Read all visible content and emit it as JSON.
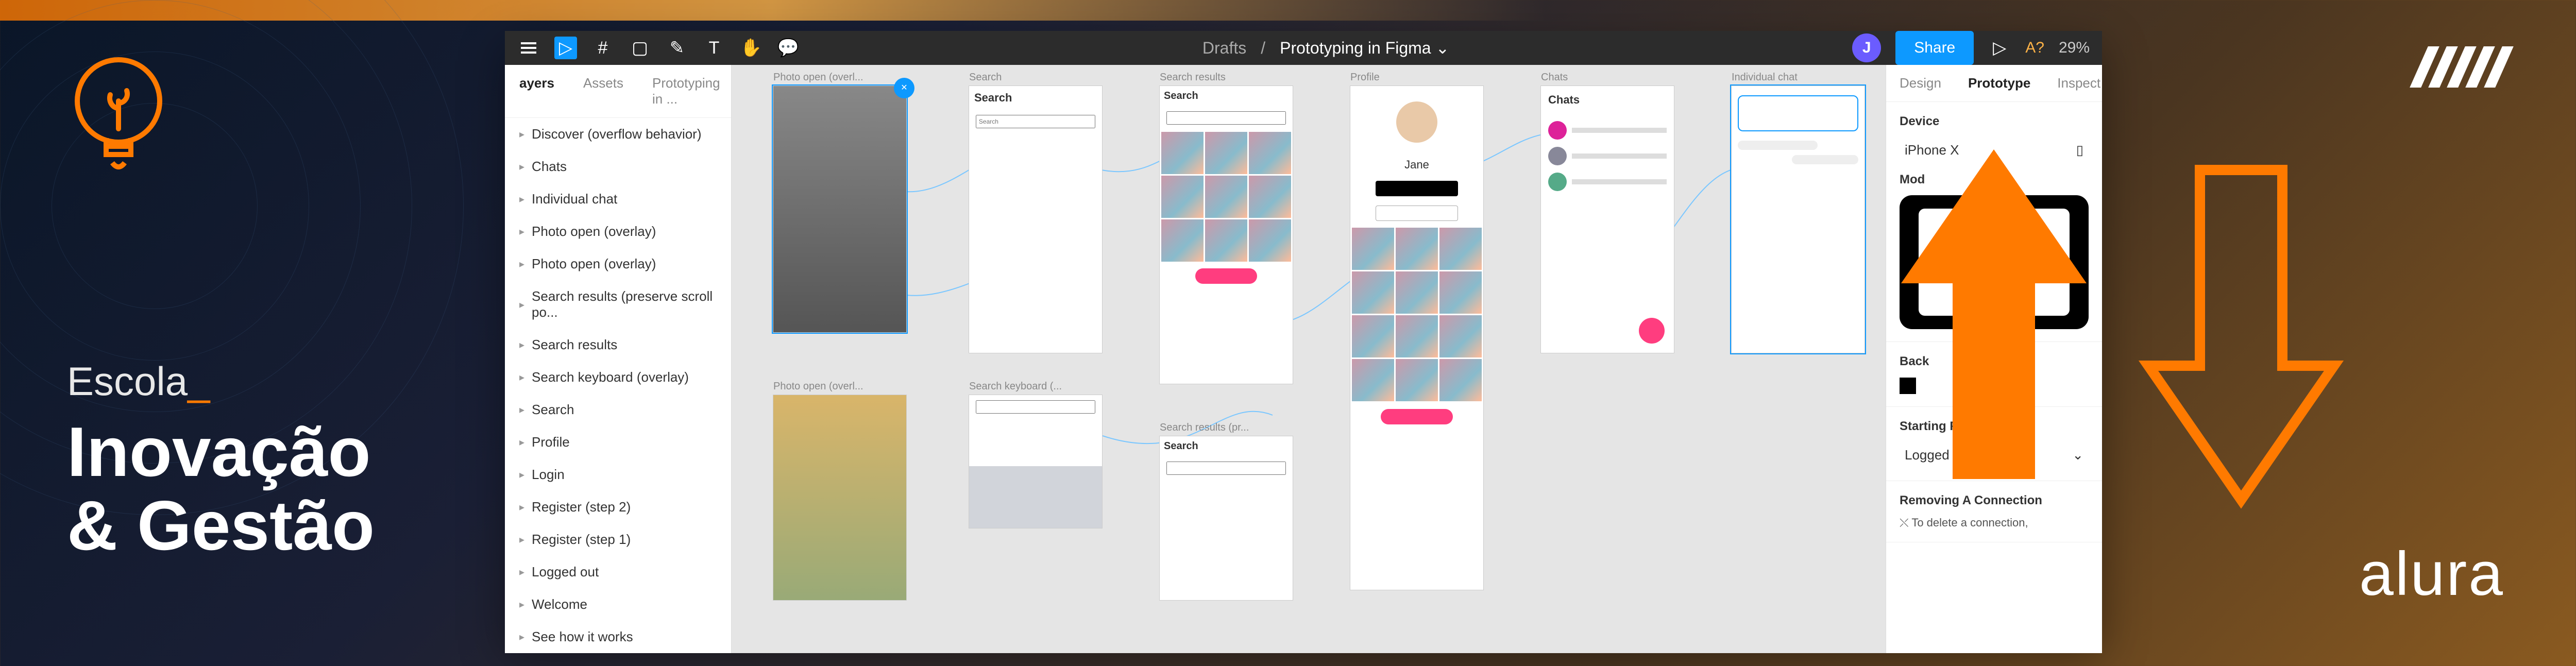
{
  "brand": {
    "school_label": "Escola",
    "cursor": "_",
    "school_name_line1": "Inovação",
    "school_name_line2": "& Gestão",
    "alura": "alura"
  },
  "figma": {
    "toolbar": {
      "breadcrumb": "Drafts",
      "separator": "/",
      "title": "Prototyping in Figma",
      "avatar_initial": "J",
      "share": "Share",
      "missing_fonts": "A?",
      "zoom": "29%"
    },
    "panel_left": {
      "tabs": {
        "layers": "ayers",
        "assets": "Assets",
        "page": "Prototyping in ..."
      },
      "items": [
        "Discover (overflow behavior)",
        "Chats",
        "Individual chat",
        "Photo open (overlay)",
        "Photo open (overlay)",
        "Search results (preserve scroll po...",
        "Search results",
        "Search keyboard (overlay)",
        "Search",
        "Profile",
        "Login",
        "Register (step 2)",
        "Register (step 1)",
        "Logged out",
        "Welcome",
        "See how it works"
      ]
    },
    "canvas": {
      "frames": {
        "photo1": "Photo open (overl...",
        "photo2": "Photo open (overl...",
        "search": "Search",
        "search_kb": "Search keyboard (...",
        "search_results": "Search results",
        "search_results_p": "Search results (pr...",
        "profile": "Profile",
        "profile_name": "Jane",
        "chats": "Chats",
        "individual_chat": "Individual chat",
        "search_field": "Search"
      }
    },
    "panel_right": {
      "tabs": {
        "design": "Design",
        "prototype": "Prototype",
        "inspect": "Inspect"
      },
      "device_label": "Device",
      "device_value": "iPhone X",
      "model_label": "Mod",
      "background_label": "Back",
      "starting_frame_label": "Starting Frame",
      "starting_frame_value": "Logged out",
      "remove_label": "Removing A Connection",
      "remove_text": "To delete a connection,"
    }
  }
}
